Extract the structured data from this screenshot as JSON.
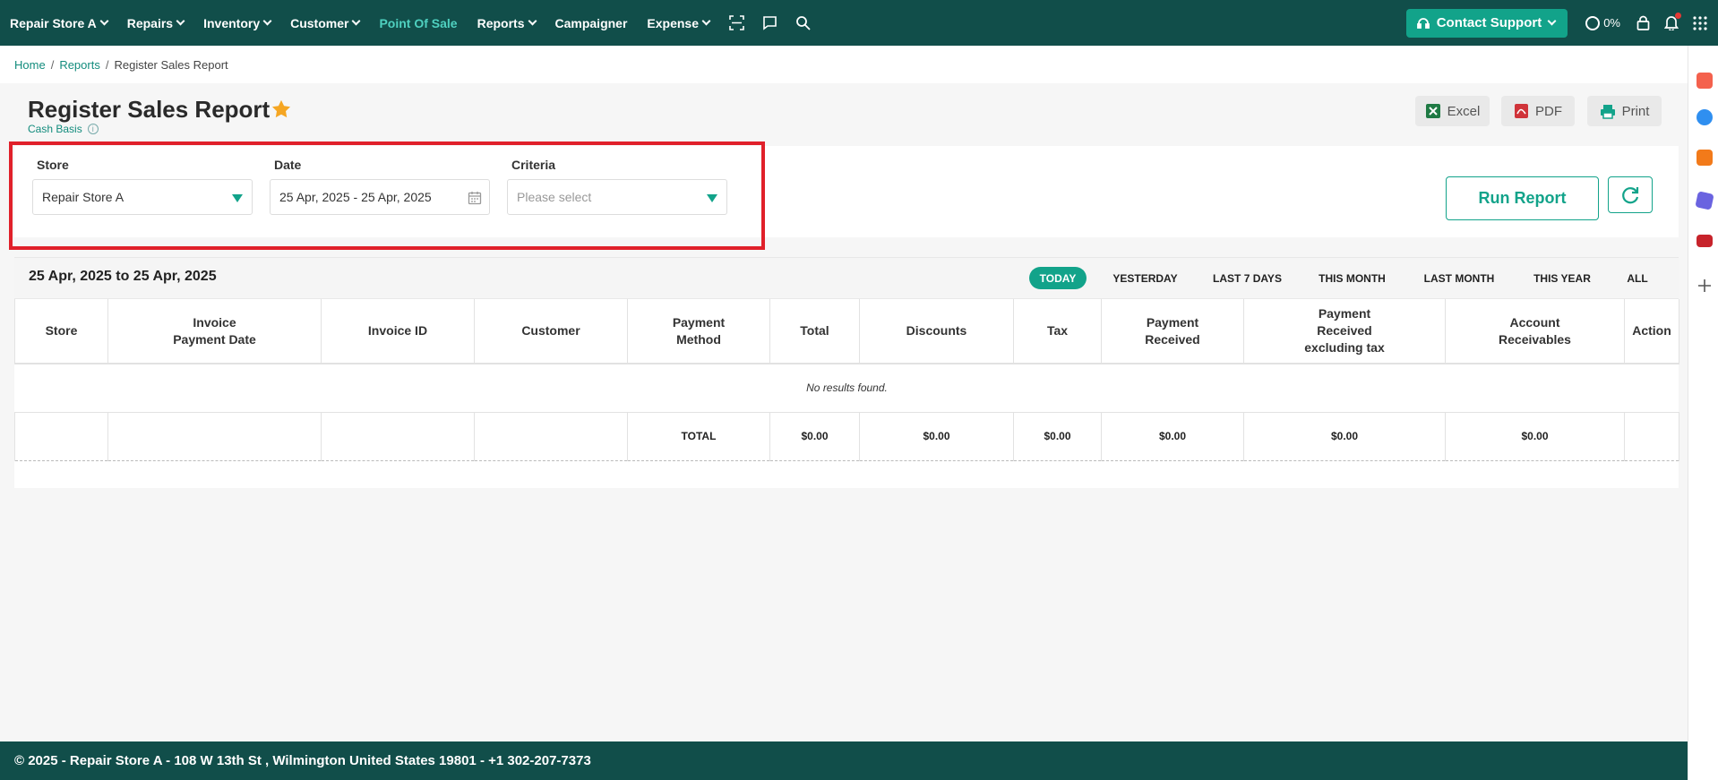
{
  "nav": {
    "items": [
      {
        "label": "Repair Store A",
        "dropdown": true
      },
      {
        "label": "Repairs",
        "dropdown": true
      },
      {
        "label": "Inventory",
        "dropdown": true
      },
      {
        "label": "Customer",
        "dropdown": true
      },
      {
        "label": "Point Of Sale",
        "dropdown": false,
        "active": true
      },
      {
        "label": "Reports",
        "dropdown": true
      },
      {
        "label": "Campaigner",
        "dropdown": false
      },
      {
        "label": "Expense",
        "dropdown": true
      }
    ],
    "icons": [
      "scan-icon",
      "chat-icon",
      "search-icon"
    ],
    "support_label": "Contact Support",
    "progress": "0%"
  },
  "breadcrumb": {
    "home": "Home",
    "reports": "Reports",
    "current": "Register Sales Report"
  },
  "page": {
    "title": "Register Sales Report",
    "subtitle": "Cash Basis",
    "export": {
      "excel": "Excel",
      "pdf": "PDF",
      "print": "Print"
    }
  },
  "filters": {
    "store_label": "Store",
    "store_value": "Repair Store A",
    "date_label": "Date",
    "date_value": "25 Apr, 2025 - 25 Apr, 2025",
    "criteria_label": "Criteria",
    "criteria_placeholder": "Please select",
    "run_label": "Run Report"
  },
  "report": {
    "range": "25 Apr, 2025 to 25 Apr, 2025",
    "quick_filters": [
      "TODAY",
      "YESTERDAY",
      "LAST 7 DAYS",
      "THIS MONTH",
      "LAST MONTH",
      "THIS YEAR",
      "ALL"
    ],
    "active_filter": "TODAY",
    "columns": [
      "Store",
      "Invoice\nPayment Date",
      "Invoice ID",
      "Customer",
      "Payment\nMethod",
      "Total",
      "Discounts",
      "Tax",
      "Payment\nReceived",
      "Payment\nReceived\nexcluding tax",
      "Account\nReceivables",
      "Action"
    ],
    "empty_message": "No results found.",
    "totals": {
      "label": "TOTAL",
      "total": "$0.00",
      "discounts": "$0.00",
      "tax": "$0.00",
      "payment_received": "$0.00",
      "payment_received_ex_tax": "$0.00",
      "account_receivables": "$0.00"
    }
  },
  "footer": {
    "text": "© 2025 - Repair Store A - 108 W 13th St , Wilmington United States 19801 - +1 302-207-7373"
  },
  "colors": {
    "nav_bg": "#114e4a",
    "accent": "#12a38a",
    "highlight": "#e0202a",
    "star": "#f5a623"
  }
}
